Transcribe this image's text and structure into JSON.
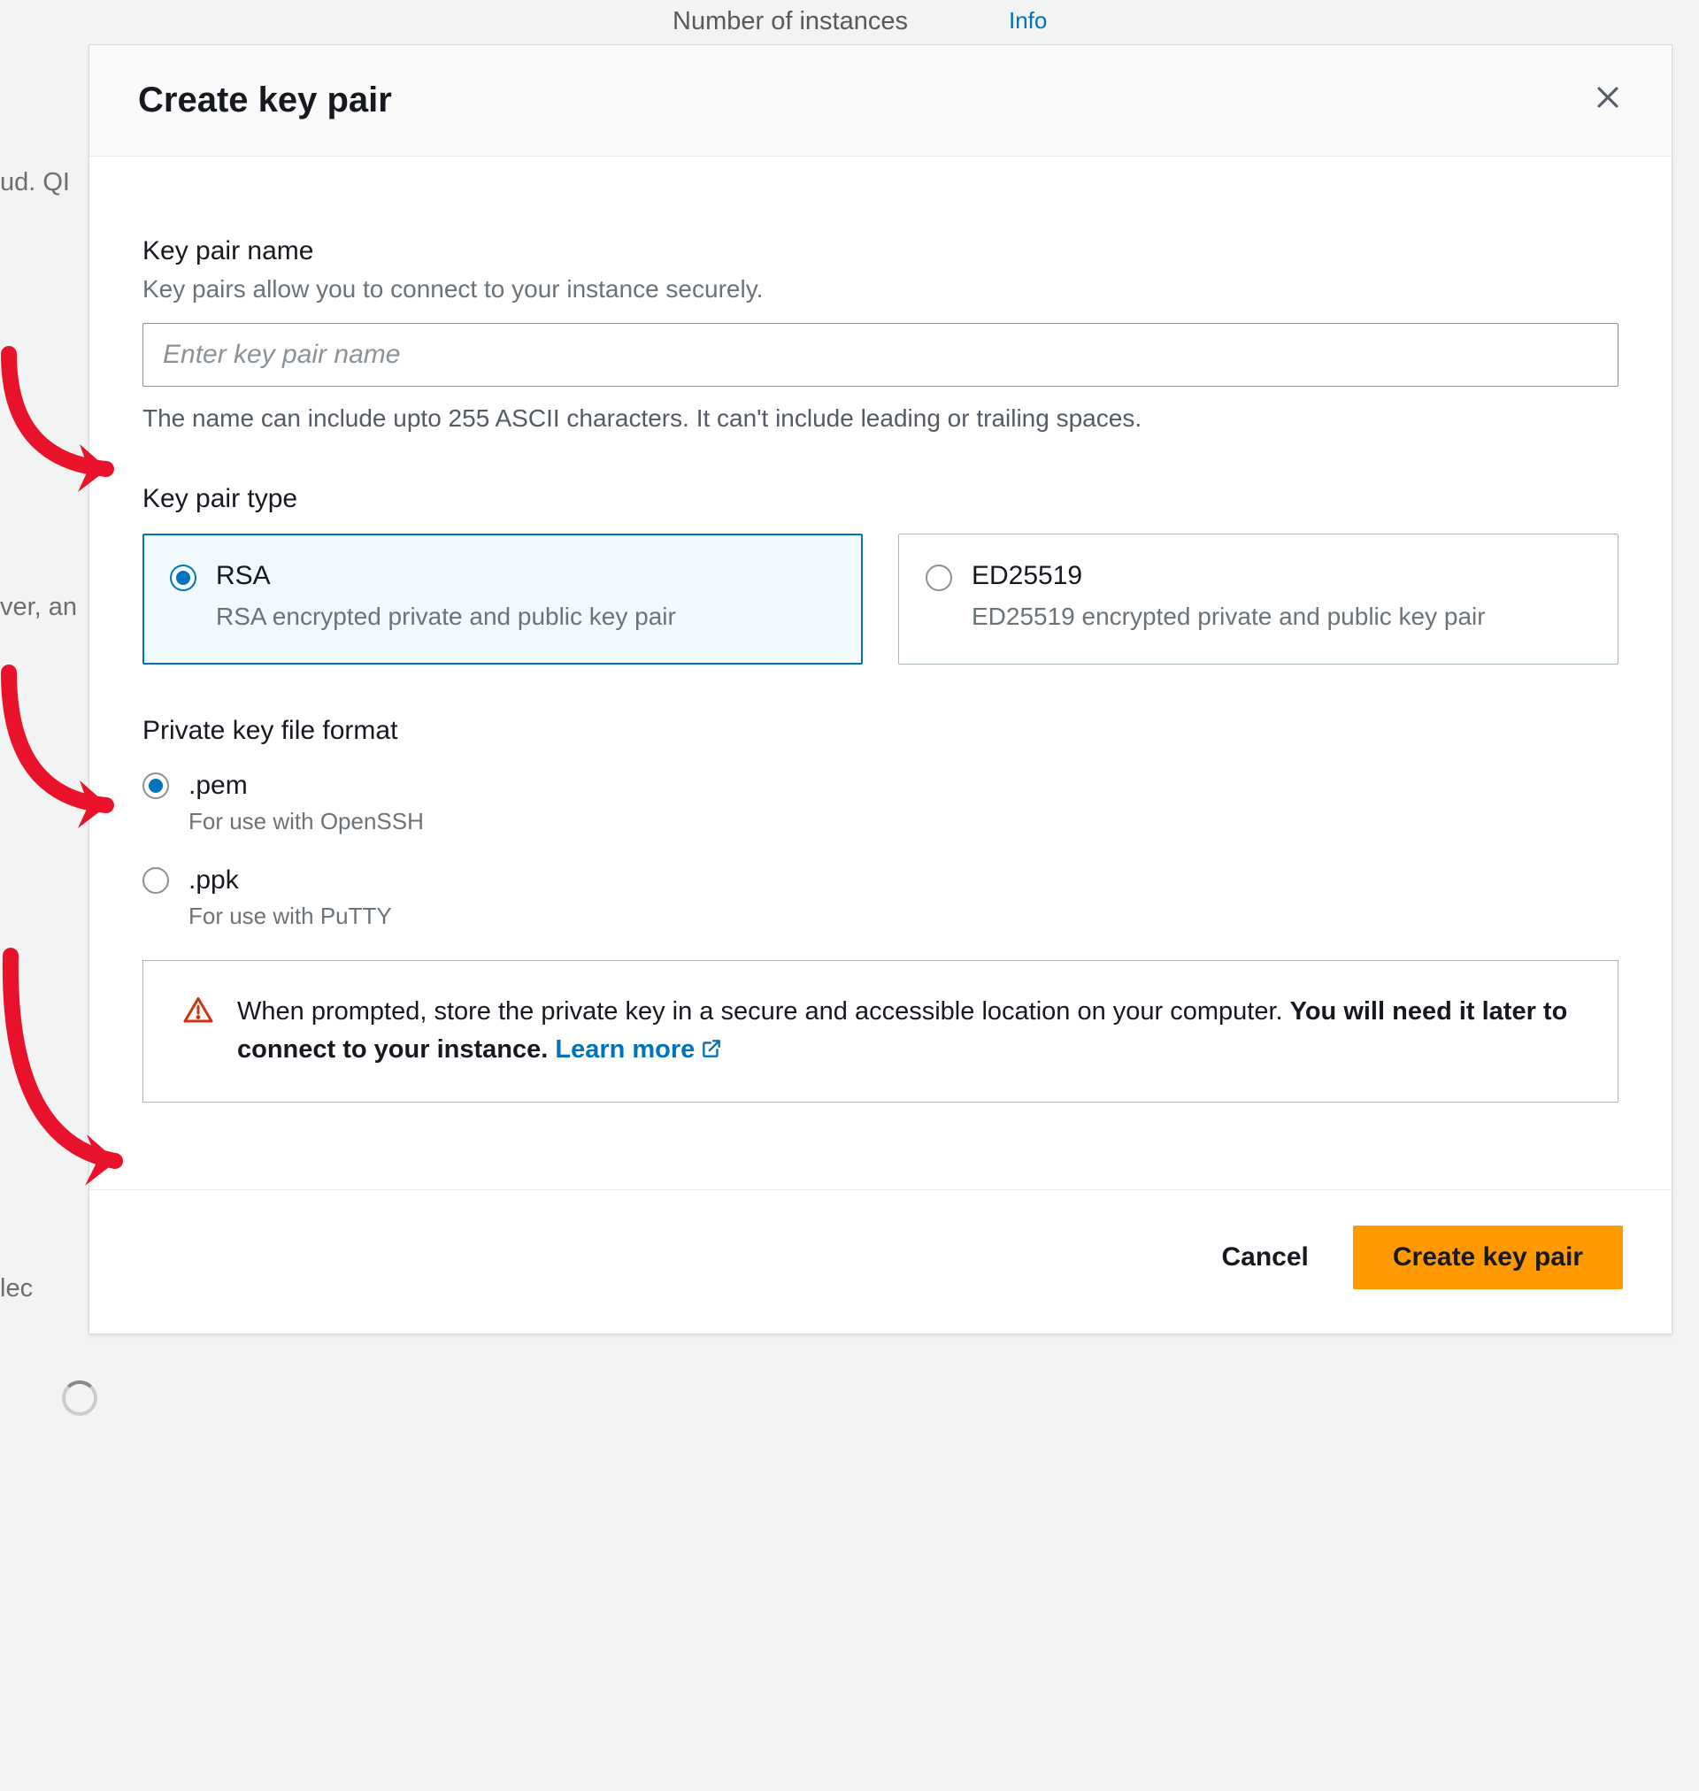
{
  "background": {
    "title": "Number of instances",
    "info_label": "Info",
    "bg_ud": "ud. QI",
    "bg_ver": "ver, an",
    "bg_lec": "lec"
  },
  "modal": {
    "title": "Create key pair",
    "name_section": {
      "label": "Key pair name",
      "help": "Key pairs allow you to connect to your instance securely.",
      "placeholder": "Enter key pair name",
      "constraint": "The name can include upto 255 ASCII characters. It can't include leading or trailing spaces."
    },
    "type_section": {
      "label": "Key pair type",
      "options": [
        {
          "title": "RSA",
          "desc": "RSA encrypted private and public key pair",
          "selected": true
        },
        {
          "title": "ED25519",
          "desc": "ED25519 encrypted private and public key pair",
          "selected": false
        }
      ]
    },
    "format_section": {
      "label": "Private key file format",
      "options": [
        {
          "title": ".pem",
          "desc": "For use with OpenSSH",
          "selected": true
        },
        {
          "title": ".ppk",
          "desc": "For use with PuTTY",
          "selected": false
        }
      ]
    },
    "alert": {
      "text_before": "When prompted, store the private key in a secure and accessible location on your computer. ",
      "text_bold": "You will need it later to connect to your instance.",
      "link_text": "Learn more"
    },
    "footer": {
      "cancel": "Cancel",
      "submit": "Create key pair"
    }
  }
}
